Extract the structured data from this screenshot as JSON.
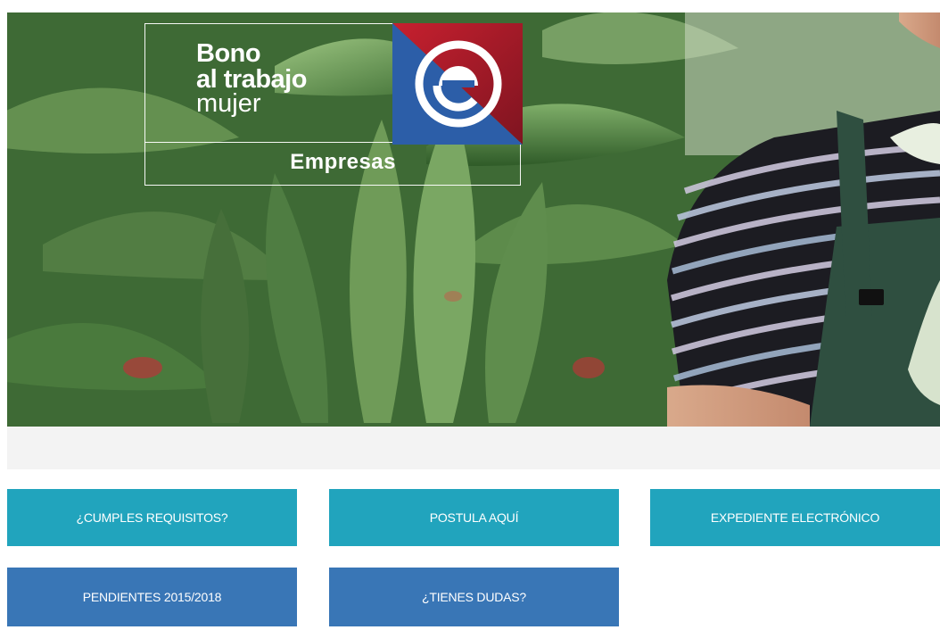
{
  "hero": {
    "logo": {
      "line1": "Bono",
      "line2": "al trabajo",
      "line3": "mujer",
      "subtitle": "Empresas",
      "emblem_icon": "e-sence-logo-icon"
    },
    "image_icon": "plants-and-woman-photo"
  },
  "buttons": {
    "cumples": "¿CUMPLES REQUISITOS?",
    "postula": "POSTULA AQUÍ",
    "expediente": "EXPEDIENTE ELECTRÓNICO",
    "pendientes": "PENDIENTES 2015/2018",
    "dudas": "¿TIENES DUDAS?"
  },
  "colors": {
    "teal": "#21a4bd",
    "blue": "#3976b6",
    "emblem_red": "#9e1b2a",
    "emblem_blue": "#2c5ea8"
  }
}
